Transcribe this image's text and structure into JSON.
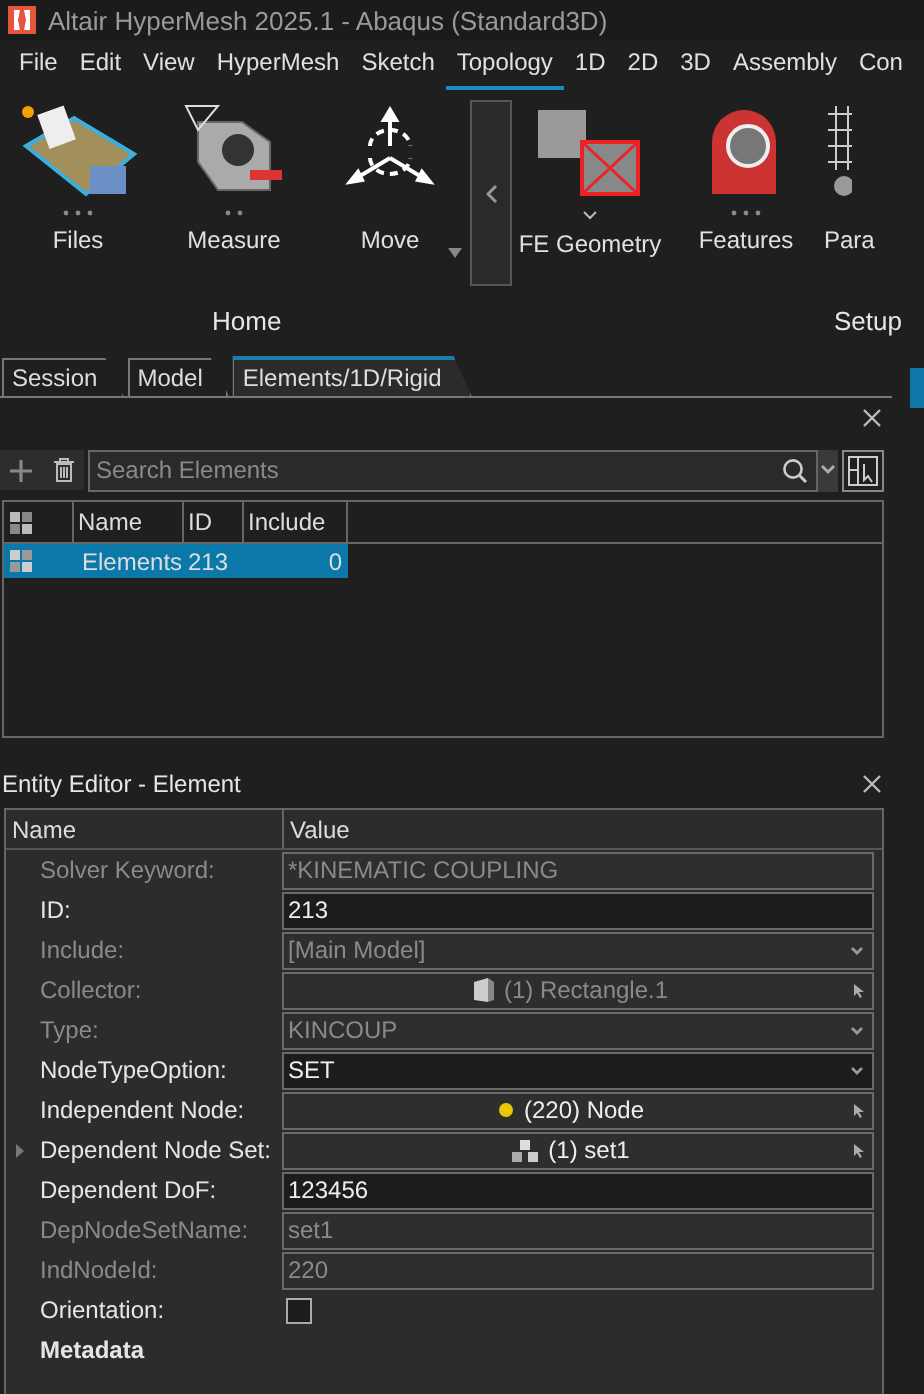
{
  "window": {
    "title": "Altair HyperMesh 2025.1 - Abaqus (Standard3D)"
  },
  "menu": [
    {
      "label": "File",
      "selected": false
    },
    {
      "label": "Edit",
      "selected": false
    },
    {
      "label": "View",
      "selected": false
    },
    {
      "label": "HyperMesh",
      "selected": false
    },
    {
      "label": "Sketch",
      "selected": false
    },
    {
      "label": "Topology",
      "selected": true
    },
    {
      "label": "1D",
      "selected": false
    },
    {
      "label": "2D",
      "selected": false
    },
    {
      "label": "3D",
      "selected": false
    },
    {
      "label": "Assembly",
      "selected": false
    },
    {
      "label": "Con",
      "selected": false
    }
  ],
  "ribbon": {
    "tools": [
      {
        "label": "Files",
        "kind": "files"
      },
      {
        "label": "Measure",
        "kind": "measure"
      },
      {
        "label": "Move",
        "kind": "move"
      },
      {
        "label": "FE Geometry",
        "kind": "fegeom"
      },
      {
        "label": "Features",
        "kind": "features"
      },
      {
        "label": "Para",
        "kind": "param"
      }
    ],
    "groups": [
      "Home",
      "Setup"
    ]
  },
  "panel_tabs": [
    {
      "label": "Session",
      "selected": false
    },
    {
      "label": "Model",
      "selected": false
    },
    {
      "label": "Elements/1D/Rigid",
      "selected": true
    }
  ],
  "browser": {
    "search": {
      "placeholder": "Search Elements"
    },
    "columns": [
      "Name",
      "ID",
      "Include"
    ],
    "rows": [
      {
        "name": "Elements",
        "id": "213",
        "include": "0",
        "selected": true
      }
    ]
  },
  "entity_editor": {
    "title": "Entity Editor - Element",
    "columns": [
      "Name",
      "Value"
    ],
    "rows": [
      {
        "label": "Solver Keyword:",
        "value": "*KINEMATIC COUPLING",
        "kind": "text",
        "disabled": true,
        "expandable": false
      },
      {
        "label": "ID:",
        "value": "213",
        "kind": "text",
        "disabled": false,
        "expandable": false
      },
      {
        "label": "Include:",
        "value": "[Main Model]",
        "kind": "dropdown",
        "disabled": true,
        "expandable": false
      },
      {
        "label": "Collector:",
        "value": "(1) Rectangle.1",
        "kind": "picker",
        "disabled": true,
        "expandable": false
      },
      {
        "label": "Type:",
        "value": "KINCOUP",
        "kind": "dropdown",
        "disabled": true,
        "expandable": false
      },
      {
        "label": "NodeTypeOption:",
        "value": "SET",
        "kind": "dropdown",
        "disabled": false,
        "expandable": false
      },
      {
        "label": "Independent Node:",
        "value": "(220) Node",
        "kind": "picker",
        "disabled": false,
        "expandable": false
      },
      {
        "label": "Dependent Node Set:",
        "value": "(1) set1",
        "kind": "picker",
        "disabled": false,
        "expandable": true
      },
      {
        "label": "Dependent DoF:",
        "value": "123456",
        "kind": "text",
        "disabled": false,
        "expandable": false
      },
      {
        "label": "DepNodeSetName:",
        "value": "set1",
        "kind": "text",
        "disabled": true,
        "expandable": false
      },
      {
        "label": "IndNodeId:",
        "value": "220",
        "kind": "text",
        "disabled": true,
        "expandable": false
      },
      {
        "label": "Orientation:",
        "kind": "checkbox",
        "checked": false,
        "disabled": false,
        "expandable": false
      },
      {
        "label": "Metadata",
        "kind": "section",
        "disabled": false,
        "expandable": false
      }
    ]
  }
}
